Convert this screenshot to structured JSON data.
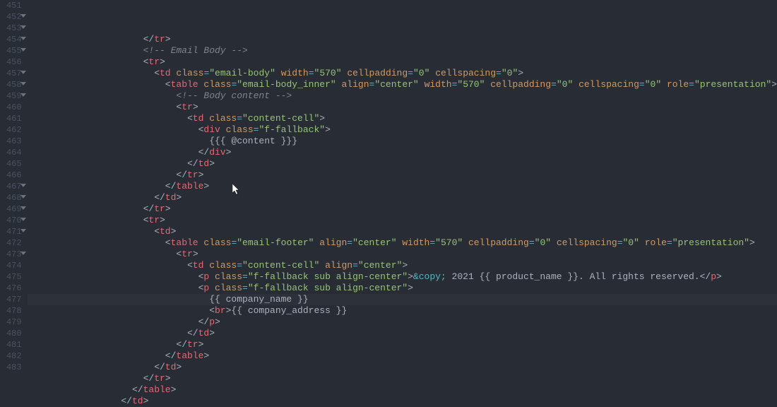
{
  "first_line_number": 451,
  "fold_lines": [
    452,
    453,
    454,
    455,
    457,
    458,
    459,
    467,
    468,
    469,
    470,
    471,
    473
  ],
  "highlighted_line": 474,
  "cursor": {
    "line": 467,
    "col": 22
  },
  "code_lines": [
    {
      "indent": 10,
      "tokens": [
        {
          "t": "angle",
          "v": "</"
        },
        {
          "t": "tag",
          "v": "tr"
        },
        {
          "t": "angle",
          "v": ">"
        }
      ]
    },
    {
      "indent": 10,
      "tokens": [
        {
          "t": "comment",
          "v": "<!-- Email Body -->"
        }
      ]
    },
    {
      "indent": 10,
      "tokens": [
        {
          "t": "angle",
          "v": "<"
        },
        {
          "t": "tag",
          "v": "tr"
        },
        {
          "t": "angle",
          "v": ">"
        }
      ]
    },
    {
      "indent": 11,
      "tokens": [
        {
          "t": "angle",
          "v": "<"
        },
        {
          "t": "tag",
          "v": "td"
        },
        {
          "t": "text",
          "v": " "
        },
        {
          "t": "attr",
          "v": "class"
        },
        {
          "t": "op",
          "v": "="
        },
        {
          "t": "str",
          "v": "\"email-body\""
        },
        {
          "t": "text",
          "v": " "
        },
        {
          "t": "attr",
          "v": "width"
        },
        {
          "t": "op",
          "v": "="
        },
        {
          "t": "str",
          "v": "\"570\""
        },
        {
          "t": "text",
          "v": " "
        },
        {
          "t": "attr",
          "v": "cellpadding"
        },
        {
          "t": "op",
          "v": "="
        },
        {
          "t": "str",
          "v": "\"0\""
        },
        {
          "t": "text",
          "v": " "
        },
        {
          "t": "attr",
          "v": "cellspacing"
        },
        {
          "t": "op",
          "v": "="
        },
        {
          "t": "str",
          "v": "\"0\""
        },
        {
          "t": "angle",
          "v": ">"
        }
      ]
    },
    {
      "indent": 12,
      "tokens": [
        {
          "t": "angle",
          "v": "<"
        },
        {
          "t": "tag",
          "v": "table"
        },
        {
          "t": "text",
          "v": " "
        },
        {
          "t": "attr",
          "v": "class"
        },
        {
          "t": "op",
          "v": "="
        },
        {
          "t": "str",
          "v": "\"email-body_inner\""
        },
        {
          "t": "text",
          "v": " "
        },
        {
          "t": "attr",
          "v": "align"
        },
        {
          "t": "op",
          "v": "="
        },
        {
          "t": "str",
          "v": "\"center\""
        },
        {
          "t": "text",
          "v": " "
        },
        {
          "t": "attr",
          "v": "width"
        },
        {
          "t": "op",
          "v": "="
        },
        {
          "t": "str",
          "v": "\"570\""
        },
        {
          "t": "text",
          "v": " "
        },
        {
          "t": "attr",
          "v": "cellpadding"
        },
        {
          "t": "op",
          "v": "="
        },
        {
          "t": "str",
          "v": "\"0\""
        },
        {
          "t": "text",
          "v": " "
        },
        {
          "t": "attr",
          "v": "cellspacing"
        },
        {
          "t": "op",
          "v": "="
        },
        {
          "t": "str",
          "v": "\"0\""
        },
        {
          "t": "text",
          "v": " "
        },
        {
          "t": "attr",
          "v": "role"
        },
        {
          "t": "op",
          "v": "="
        },
        {
          "t": "str",
          "v": "\"presentation\""
        },
        {
          "t": "angle",
          "v": ">"
        }
      ]
    },
    {
      "indent": 13,
      "tokens": [
        {
          "t": "comment",
          "v": "<!-- Body content -->"
        }
      ]
    },
    {
      "indent": 13,
      "tokens": [
        {
          "t": "angle",
          "v": "<"
        },
        {
          "t": "tag",
          "v": "tr"
        },
        {
          "t": "angle",
          "v": ">"
        }
      ]
    },
    {
      "indent": 14,
      "tokens": [
        {
          "t": "angle",
          "v": "<"
        },
        {
          "t": "tag",
          "v": "td"
        },
        {
          "t": "text",
          "v": " "
        },
        {
          "t": "attr",
          "v": "class"
        },
        {
          "t": "op",
          "v": "="
        },
        {
          "t": "str",
          "v": "\"content-cell\""
        },
        {
          "t": "angle",
          "v": ">"
        }
      ]
    },
    {
      "indent": 15,
      "tokens": [
        {
          "t": "angle",
          "v": "<"
        },
        {
          "t": "tag",
          "v": "div"
        },
        {
          "t": "text",
          "v": " "
        },
        {
          "t": "attr",
          "v": "class"
        },
        {
          "t": "op",
          "v": "="
        },
        {
          "t": "str",
          "v": "\"f-fallback\""
        },
        {
          "t": "angle",
          "v": ">"
        }
      ]
    },
    {
      "indent": 16,
      "tokens": [
        {
          "t": "text",
          "v": "{{{ @content }}}"
        }
      ]
    },
    {
      "indent": 15,
      "tokens": [
        {
          "t": "angle",
          "v": "</"
        },
        {
          "t": "tag",
          "v": "div"
        },
        {
          "t": "angle",
          "v": ">"
        }
      ]
    },
    {
      "indent": 14,
      "tokens": [
        {
          "t": "angle",
          "v": "</"
        },
        {
          "t": "tag",
          "v": "td"
        },
        {
          "t": "angle",
          "v": ">"
        }
      ]
    },
    {
      "indent": 13,
      "tokens": [
        {
          "t": "angle",
          "v": "</"
        },
        {
          "t": "tag",
          "v": "tr"
        },
        {
          "t": "angle",
          "v": ">"
        }
      ]
    },
    {
      "indent": 12,
      "tokens": [
        {
          "t": "angle",
          "v": "</"
        },
        {
          "t": "tag",
          "v": "table"
        },
        {
          "t": "angle",
          "v": ">"
        }
      ]
    },
    {
      "indent": 11,
      "tokens": [
        {
          "t": "angle",
          "v": "</"
        },
        {
          "t": "tag",
          "v": "td"
        },
        {
          "t": "angle",
          "v": ">"
        }
      ]
    },
    {
      "indent": 10,
      "tokens": [
        {
          "t": "angle",
          "v": "</"
        },
        {
          "t": "tag",
          "v": "tr"
        },
        {
          "t": "angle",
          "v": ">"
        }
      ]
    },
    {
      "indent": 10,
      "tokens": [
        {
          "t": "angle",
          "v": "<"
        },
        {
          "t": "tag",
          "v": "tr"
        },
        {
          "t": "angle",
          "v": ">"
        }
      ]
    },
    {
      "indent": 11,
      "tokens": [
        {
          "t": "angle",
          "v": "<"
        },
        {
          "t": "tag",
          "v": "td"
        },
        {
          "t": "angle",
          "v": ">"
        }
      ]
    },
    {
      "indent": 12,
      "tokens": [
        {
          "t": "angle",
          "v": "<"
        },
        {
          "t": "tag",
          "v": "table"
        },
        {
          "t": "text",
          "v": " "
        },
        {
          "t": "attr",
          "v": "class"
        },
        {
          "t": "op",
          "v": "="
        },
        {
          "t": "str",
          "v": "\"email-footer\""
        },
        {
          "t": "text",
          "v": " "
        },
        {
          "t": "attr",
          "v": "align"
        },
        {
          "t": "op",
          "v": "="
        },
        {
          "t": "str",
          "v": "\"center\""
        },
        {
          "t": "text",
          "v": " "
        },
        {
          "t": "attr",
          "v": "width"
        },
        {
          "t": "op",
          "v": "="
        },
        {
          "t": "str",
          "v": "\"570\""
        },
        {
          "t": "text",
          "v": " "
        },
        {
          "t": "attr",
          "v": "cellpadding"
        },
        {
          "t": "op",
          "v": "="
        },
        {
          "t": "str",
          "v": "\"0\""
        },
        {
          "t": "text",
          "v": " "
        },
        {
          "t": "attr",
          "v": "cellspacing"
        },
        {
          "t": "op",
          "v": "="
        },
        {
          "t": "str",
          "v": "\"0\""
        },
        {
          "t": "text",
          "v": " "
        },
        {
          "t": "attr",
          "v": "role"
        },
        {
          "t": "op",
          "v": "="
        },
        {
          "t": "str",
          "v": "\"presentation\""
        },
        {
          "t": "angle",
          "v": ">"
        }
      ]
    },
    {
      "indent": 13,
      "tokens": [
        {
          "t": "angle",
          "v": "<"
        },
        {
          "t": "tag",
          "v": "tr"
        },
        {
          "t": "angle",
          "v": ">"
        }
      ]
    },
    {
      "indent": 14,
      "tokens": [
        {
          "t": "angle",
          "v": "<"
        },
        {
          "t": "tag",
          "v": "td"
        },
        {
          "t": "text",
          "v": " "
        },
        {
          "t": "attr",
          "v": "class"
        },
        {
          "t": "op",
          "v": "="
        },
        {
          "t": "str",
          "v": "\"content-cell\""
        },
        {
          "t": "text",
          "v": " "
        },
        {
          "t": "attr",
          "v": "align"
        },
        {
          "t": "op",
          "v": "="
        },
        {
          "t": "str",
          "v": "\"center\""
        },
        {
          "t": "angle",
          "v": ">"
        }
      ]
    },
    {
      "indent": 15,
      "tokens": [
        {
          "t": "angle",
          "v": "<"
        },
        {
          "t": "tag",
          "v": "p"
        },
        {
          "t": "text",
          "v": " "
        },
        {
          "t": "attr",
          "v": "class"
        },
        {
          "t": "op",
          "v": "="
        },
        {
          "t": "str",
          "v": "\"f-fallback sub align-center\""
        },
        {
          "t": "angle",
          "v": ">"
        },
        {
          "t": "entity",
          "v": "&copy;"
        },
        {
          "t": "text",
          "v": " 2021 {{ product_name }}. All rights reserved."
        },
        {
          "t": "angle",
          "v": "</"
        },
        {
          "t": "tag",
          "v": "p"
        },
        {
          "t": "angle",
          "v": ">"
        }
      ]
    },
    {
      "indent": 15,
      "tokens": [
        {
          "t": "angle",
          "v": "<"
        },
        {
          "t": "tag",
          "v": "p"
        },
        {
          "t": "text",
          "v": " "
        },
        {
          "t": "attr",
          "v": "class"
        },
        {
          "t": "op",
          "v": "="
        },
        {
          "t": "str",
          "v": "\"f-fallback sub align-center\""
        },
        {
          "t": "angle",
          "v": ">"
        }
      ]
    },
    {
      "indent": 16,
      "tokens": [
        {
          "t": "text",
          "v": "{{ company_name }}"
        }
      ]
    },
    {
      "indent": 16,
      "tokens": [
        {
          "t": "angle",
          "v": "<"
        },
        {
          "t": "tag",
          "v": "br"
        },
        {
          "t": "angle",
          "v": ">"
        },
        {
          "t": "text",
          "v": "{{ company_address }}"
        }
      ]
    },
    {
      "indent": 15,
      "tokens": [
        {
          "t": "angle",
          "v": "</"
        },
        {
          "t": "tag",
          "v": "p"
        },
        {
          "t": "angle",
          "v": ">"
        }
      ]
    },
    {
      "indent": 14,
      "tokens": [
        {
          "t": "angle",
          "v": "</"
        },
        {
          "t": "tag",
          "v": "td"
        },
        {
          "t": "angle",
          "v": ">"
        }
      ]
    },
    {
      "indent": 13,
      "tokens": [
        {
          "t": "angle",
          "v": "</"
        },
        {
          "t": "tag",
          "v": "tr"
        },
        {
          "t": "angle",
          "v": ">"
        }
      ]
    },
    {
      "indent": 12,
      "tokens": [
        {
          "t": "angle",
          "v": "</"
        },
        {
          "t": "tag",
          "v": "table"
        },
        {
          "t": "angle",
          "v": ">"
        }
      ]
    },
    {
      "indent": 11,
      "tokens": [
        {
          "t": "angle",
          "v": "</"
        },
        {
          "t": "tag",
          "v": "td"
        },
        {
          "t": "angle",
          "v": ">"
        }
      ]
    },
    {
      "indent": 10,
      "tokens": [
        {
          "t": "angle",
          "v": "</"
        },
        {
          "t": "tag",
          "v": "tr"
        },
        {
          "t": "angle",
          "v": ">"
        }
      ]
    },
    {
      "indent": 9,
      "tokens": [
        {
          "t": "angle",
          "v": "</"
        },
        {
          "t": "tag",
          "v": "table"
        },
        {
          "t": "angle",
          "v": ">"
        }
      ]
    },
    {
      "indent": 8,
      "tokens": [
        {
          "t": "angle",
          "v": "</"
        },
        {
          "t": "tag",
          "v": "td"
        },
        {
          "t": "angle",
          "v": ">"
        }
      ]
    }
  ]
}
